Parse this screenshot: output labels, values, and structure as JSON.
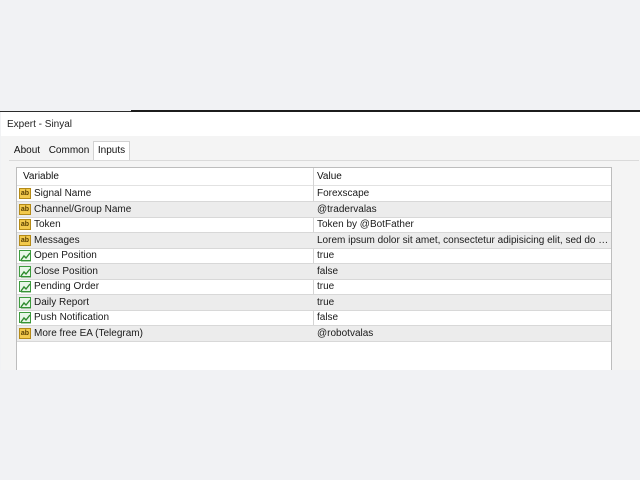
{
  "window": {
    "title": "Expert - Sinyal"
  },
  "tabs": [
    {
      "label": "About",
      "active": false
    },
    {
      "label": "Common",
      "active": false
    },
    {
      "label": "Inputs",
      "active": true
    }
  ],
  "table": {
    "headers": {
      "variable": "Variable",
      "value": "Value"
    },
    "rows": [
      {
        "icon": "text-param-icon",
        "variable": "Signal Name",
        "value": "Forexscape"
      },
      {
        "icon": "text-param-icon",
        "variable": "Channel/Group Name",
        "value": "@tradervalas"
      },
      {
        "icon": "text-param-icon",
        "variable": "Token",
        "value": "Token by @BotFather"
      },
      {
        "icon": "text-param-icon",
        "variable": "Messages",
        "value": "Lorem ipsum dolor sit amet, consectetur adipisicing elit, sed do eiusmod tempor"
      },
      {
        "icon": "bool-param-icon",
        "variable": "Open Position",
        "value": "true"
      },
      {
        "icon": "bool-param-icon",
        "variable": "Close Position",
        "value": "false"
      },
      {
        "icon": "bool-param-icon",
        "variable": "Pending Order",
        "value": "true"
      },
      {
        "icon": "bool-param-icon",
        "variable": "Daily Report",
        "value": "true"
      },
      {
        "icon": "bool-param-icon",
        "variable": "Push Notification",
        "value": "false"
      },
      {
        "icon": "text-param-icon",
        "variable": "More free EA (Telegram)",
        "value": "@robotvalas"
      }
    ]
  },
  "colors": {
    "background": "#f1f2f4",
    "alt_row": "#ececec",
    "text_icon": "#f2c94c",
    "bool_icon": "#3d9b3d"
  }
}
